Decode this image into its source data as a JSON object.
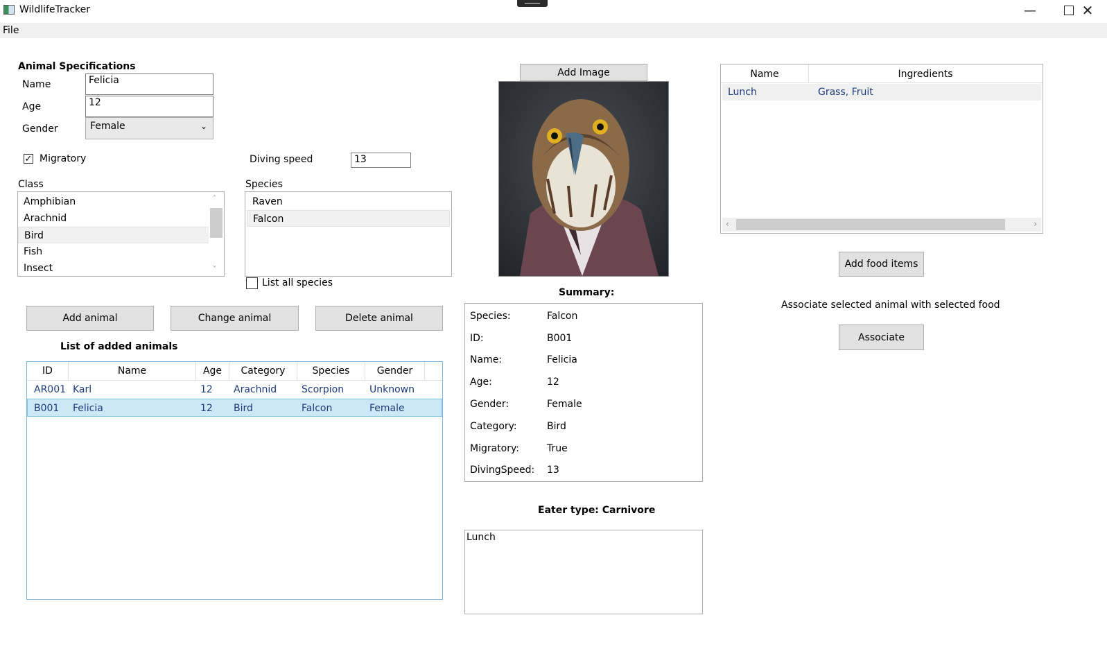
{
  "window": {
    "title": "WildlifeTracker"
  },
  "menu": {
    "file": "File"
  },
  "specs": {
    "heading": "Animal Specifications",
    "name_label": "Name",
    "name_value": "Felicia",
    "age_label": "Age",
    "age_value": "12",
    "gender_label": "Gender",
    "gender_value": "Female",
    "migratory_label": "Migratory",
    "migratory_checked": true,
    "diving_label": "Diving speed",
    "diving_value": "13"
  },
  "class_list": {
    "label": "Class",
    "items": [
      "Amphibian",
      "Arachnid",
      "Bird",
      "Fish",
      "Insect"
    ],
    "selected": "Bird"
  },
  "species_list": {
    "label": "Species",
    "items": [
      "Raven",
      "Falcon"
    ],
    "selected": "Falcon",
    "list_all_label": "List all species"
  },
  "buttons": {
    "add": "Add animal",
    "change": "Change animal",
    "delete": "Delete animal",
    "add_image": "Add Image",
    "add_food": "Add food items",
    "associate": "Associate"
  },
  "animals": {
    "heading": "List of added animals",
    "columns": [
      "ID",
      "Name",
      "Age",
      "Category",
      "Species",
      "Gender"
    ],
    "rows": [
      [
        "AR001",
        "Karl",
        "12",
        "Arachnid",
        "Scorpion",
        "Unknown"
      ],
      [
        "B001",
        "Felicia",
        "12",
        "Bird",
        "Falcon",
        "Female"
      ]
    ],
    "selected_row": 1
  },
  "summary": {
    "heading": "Summary:",
    "rows": [
      [
        "Species:",
        "Falcon"
      ],
      [
        "ID:",
        "B001"
      ],
      [
        "Name:",
        "Felicia"
      ],
      [
        "Age:",
        "12"
      ],
      [
        "Gender:",
        "Female"
      ],
      [
        "Category:",
        "Bird"
      ],
      [
        "Migratory:",
        "True"
      ],
      [
        "DivingSpeed:",
        "13"
      ]
    ]
  },
  "eater": {
    "label": "Eater type: Carnivore",
    "food_text": "Lunch"
  },
  "food_grid": {
    "columns": [
      "Name",
      "Ingredients"
    ],
    "rows": [
      [
        "Lunch",
        "Grass, Fruit"
      ]
    ]
  },
  "associate_text": "Associate selected animal with selected food",
  "icons": {
    "minimize": "minimize-icon",
    "maximize": "maximize-icon",
    "close": "close-icon"
  },
  "colors": {
    "selection": "#cce8f7",
    "grid_border": "#7fb3e0",
    "row_text": "#1b3a7a"
  }
}
